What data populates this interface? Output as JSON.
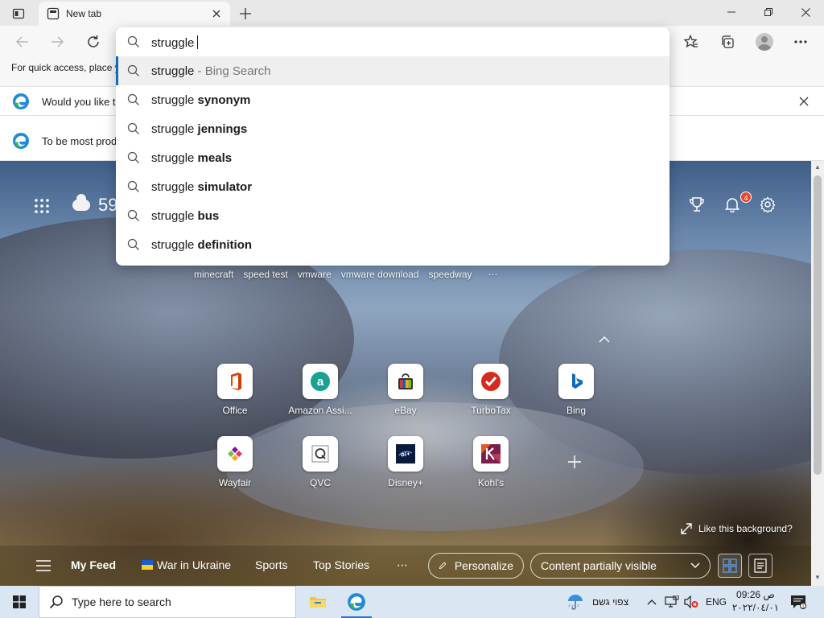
{
  "browser": {
    "tab_title": "New tab",
    "favorites_hint": "For quick access, place y",
    "infobar1_text": "Would you like t",
    "infobar2_text": "To be most prod"
  },
  "omnibox": {
    "typed": "struggle",
    "suggestions": [
      {
        "prefix": "struggle",
        "bold": "",
        "suffix": " - Bing Search"
      },
      {
        "prefix": "struggle ",
        "bold": "synonym",
        "suffix": ""
      },
      {
        "prefix": "struggle ",
        "bold": "jennings",
        "suffix": ""
      },
      {
        "prefix": "struggle ",
        "bold": "meals",
        "suffix": ""
      },
      {
        "prefix": "struggle ",
        "bold": "simulator",
        "suffix": ""
      },
      {
        "prefix": "struggle ",
        "bold": "bus",
        "suffix": ""
      },
      {
        "prefix": "struggle ",
        "bold": "definition",
        "suffix": ""
      }
    ]
  },
  "ntp": {
    "weather_temp": "59",
    "notification_count": "4",
    "trending": [
      "minecraft",
      "speed test",
      "vmware",
      "vmware download",
      "speedway",
      "⋯"
    ],
    "tiles_row1": [
      {
        "label": "Office",
        "icon": "office-icon"
      },
      {
        "label": "Amazon Assi...",
        "icon": "amazon-icon"
      },
      {
        "label": "eBay",
        "icon": "ebay-icon"
      },
      {
        "label": "TurboTax",
        "icon": "turbotax-icon"
      },
      {
        "label": "Bing",
        "icon": "bing-icon"
      }
    ],
    "tiles_row2": [
      {
        "label": "Wayfair",
        "icon": "wayfair-icon"
      },
      {
        "label": "QVC",
        "icon": "qvc-icon"
      },
      {
        "label": "Disney+",
        "icon": "disney-icon"
      },
      {
        "label": "Kohl's",
        "icon": "kohls-icon"
      }
    ],
    "like_background": "Like this background?",
    "feed": {
      "my_feed": "My Feed",
      "war_in_ukraine": "War in Ukraine",
      "sports": "Sports",
      "top_stories": "Top Stories",
      "more": "⋯",
      "personalize": "Personalize",
      "content_visibility": "Content partially visible"
    }
  },
  "taskbar": {
    "search_placeholder": "Type here to search",
    "weather_text": "צפוי גשם",
    "language": "ENG",
    "time": "09:26 ص",
    "date": "٢٠٢٢/٠٤/٠١"
  },
  "colors": {
    "accent": "#0f6cbd",
    "badge": "#e8442c",
    "taskbar": "#dbe6f3"
  }
}
